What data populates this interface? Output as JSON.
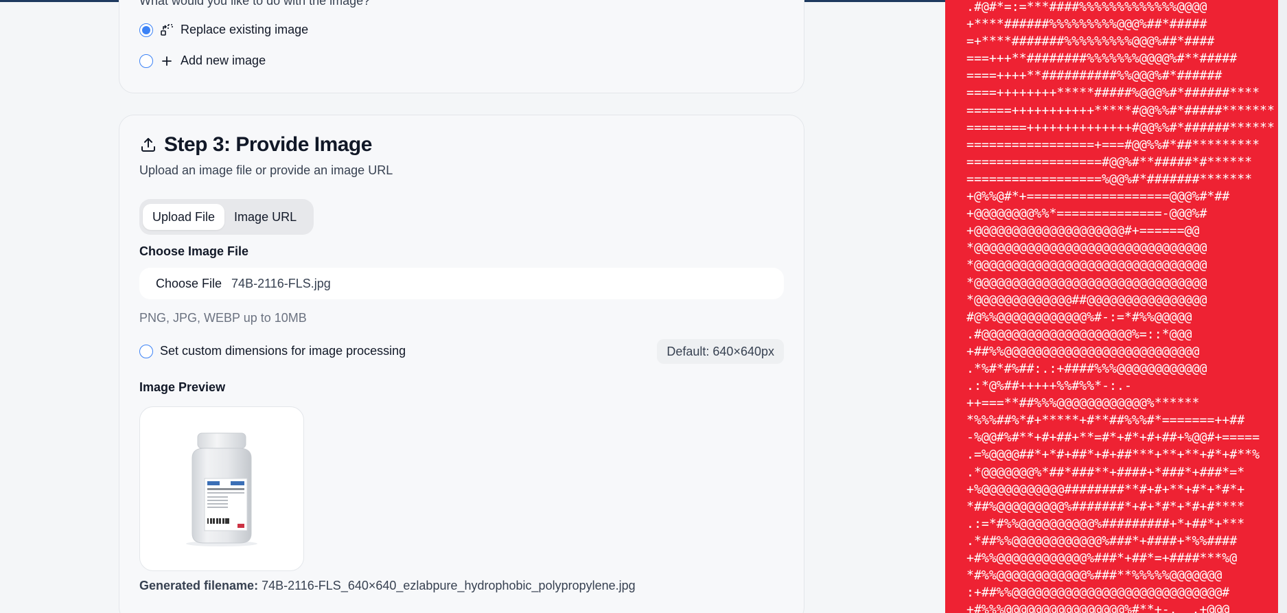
{
  "step2": {
    "question": "What would you like to do with the image?",
    "options": [
      {
        "label": "Replace existing image",
        "icon": "replace-icon",
        "selected": true
      },
      {
        "label": "Add new image",
        "icon": "plus-icon",
        "selected": false
      }
    ]
  },
  "step3": {
    "title": "Step 3: Provide Image",
    "subtitle": "Upload an image file or provide an image URL",
    "tabs": [
      {
        "label": "Upload File",
        "active": true
      },
      {
        "label": "Image URL",
        "active": false
      }
    ],
    "file_label": "Choose Image File",
    "file_button": "Choose File",
    "file_name": "74B-2116-FLS.jpg",
    "file_hint": "PNG, JPG, WEBP up to 10MB",
    "custom_dimensions_label": "Set custom dimensions for image processing",
    "custom_dimensions_checked": false,
    "default_dimensions": "Default: 640×640px",
    "preview_label": "Image Preview",
    "generated_label": "Generated filename:",
    "generated_value": "74B-2116-FLS_640×640_ezlabpure_hydrophobic_polypropylene.jpg"
  },
  "ascii_art": {
    "lines": [
      ".#@#*=:=***####%%%%%%%%%%%%%@@@@",
      "+****######%%%%%%%%%@@@%##*#####",
      "=+****#######%%%%%%%%%@@@%##*####",
      "===+++**########%%%%%%%@@@@%#**#####",
      "====++++**##########%%@@@%#*######",
      "====++++++++*****#####%@@@%#*######****",
      "======+++++++++++*****#@@%%#*#####*******",
      "========++++++++++++++#@@%%#*######******",
      "=================+===#@@%%#*##*********",
      "==================#@@%#**#####*#******",
      "==================%@@%#*#######*******",
      "+@%%@#*+===================@@@%#*##",
      "+@@@@@@@@%%*==============-@@@%#",
      "+@@@@@@@@@@@@@@@@@@@@#+======@@",
      "*@@@@@@@@@@@@@@@@@@@@@@@@@@@@@@@",
      "*@@@@@@@@@@@@@@@@@@@@@@@@@@@@@@@",
      "*@@@@@@@@@@@@@@@@@@@@@@@@@@@@@@@",
      "*@@@@@@@@@@@@@##@@@@@@@@@@@@@@@@",
      "#@%%@@@@@@@@@@@@%#-:=*#%%@@@@@",
      ".#@@@@@@@@@@@@@@@@@@@@%=::*@@@",
      "+##%%@@@@@@@@@@@@@@@@@@@@@@@@@@",
      ".*%#*#%##:.:+####%%%@@@@@@@@@@@@",
      ".:*@%##+++++%%#%%*-:.-",
      "++===**##%%%@@@@@@@@@@@@%******",
      "*%%%##%*#+*****+#**##%%%#*=======++##",
      "-%@@#%#**+#+##+**=#*+#*+#+##+%@@#+=====",
      ".=%@@@@##*+*#+##*+#+##***+**+**+#*+#**%",
      ".*@@@@@@@%*##*###**+####+*###*+###*=*",
      "+%@@@@@@@@@@@########**#+#+**+#*+*#*+",
      "*##%@@@@@@@@@%#######*+#+*#*+*#+#****",
      ".:=*#%%@@@@@@@@@@%#########+*+##*+***",
      ".*##%%@@@@@@@@@@@@%###*+####+*%%####",
      "+#%%@@@@@@@@@@@@%###*+##*=+####***%@",
      "*#%%@@@@@@@@@@@@%###**%%%%%@@@@@@@",
      ":+##%%@@@@@@@@@@@@@@@@@@@@@@@@@@@@#",
      "+#%%%@@@@@@@@@@@@@@@@%#**+-.  .+@@@"
    ]
  }
}
